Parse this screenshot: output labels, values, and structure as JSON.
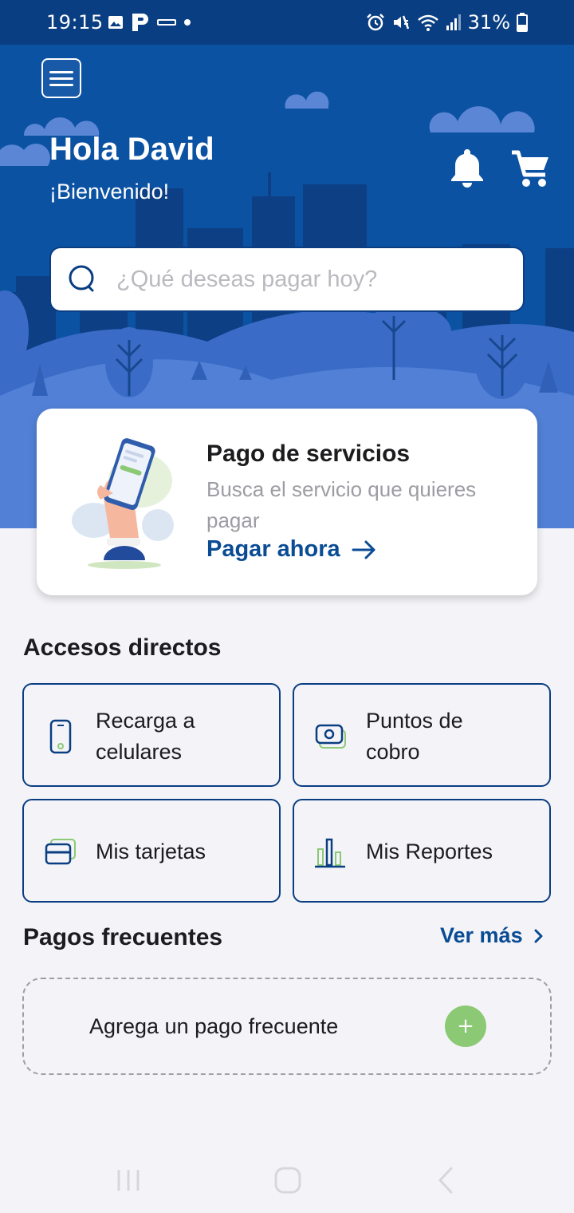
{
  "status_bar": {
    "time": "19:15",
    "battery": "31%",
    "icons": [
      "image-icon",
      "parking-icon",
      "turbo-icon",
      "dot-icon",
      "alarm-icon",
      "mute-icon",
      "wifi-icon",
      "signal-icon",
      "battery-icon"
    ]
  },
  "header": {
    "greeting": "Hola David",
    "welcome": "¡Bienvenido!",
    "search_placeholder": "¿Qué deseas pagar hoy?"
  },
  "service_card": {
    "title": "Pago de servicios",
    "description": "Busca el servicio que quieres pagar",
    "cta": "Pagar ahora"
  },
  "shortcuts": {
    "title": "Accesos directos",
    "items": [
      {
        "label_line1": "Recarga a",
        "label_line2": "celulares",
        "icon": "phone-icon"
      },
      {
        "label_line1": "Puntos de",
        "label_line2": "cobro",
        "icon": "cash-icon"
      },
      {
        "label": "Mis tarjetas",
        "icon": "card-icon"
      },
      {
        "label": "Mis Reportes",
        "icon": "chart-icon"
      }
    ]
  },
  "frequent_payments": {
    "title": "Pagos frecuentes",
    "see_more": "Ver más",
    "add_label": "Agrega un pago frecuente",
    "add_button": "+"
  },
  "colors": {
    "primary": "#0c52a3",
    "dark_blue": "#0a3e82",
    "link_blue": "#0a4c94",
    "accent_green": "#8bc975",
    "background": "#f4f4f8"
  }
}
